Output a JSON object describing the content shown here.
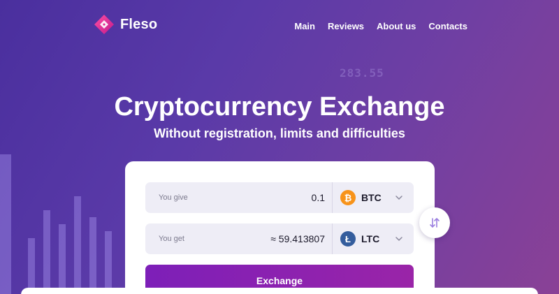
{
  "brand": {
    "name": "Fleso",
    "logo_icon": "diamond-logo-icon"
  },
  "nav": [
    {
      "label": "Main"
    },
    {
      "label": "Reviews"
    },
    {
      "label": "About us"
    },
    {
      "label": "Contacts"
    }
  ],
  "hero": {
    "title": "Cryptocurrency Exchange",
    "subtitle": "Without registration, limits and difficulties"
  },
  "background": {
    "price_ticker": "283.55"
  },
  "exchange": {
    "give": {
      "label": "You give",
      "value": "0.1",
      "currency": "BTC",
      "coin_icon": "bitcoin-icon",
      "coin_color": "#f7931a"
    },
    "get": {
      "label": "You get",
      "value": "≈ 59.413807",
      "currency": "LTC",
      "coin_icon": "litecoin-icon",
      "coin_color": "#345d9d"
    },
    "swap_icon": "swap-arrows-icon",
    "submit_label": "Exchange"
  },
  "colors": {
    "accent_start": "#7d1fb8",
    "accent_end": "#9a24a8",
    "background_start": "#4a2f9e",
    "background_end": "#8a4196"
  }
}
